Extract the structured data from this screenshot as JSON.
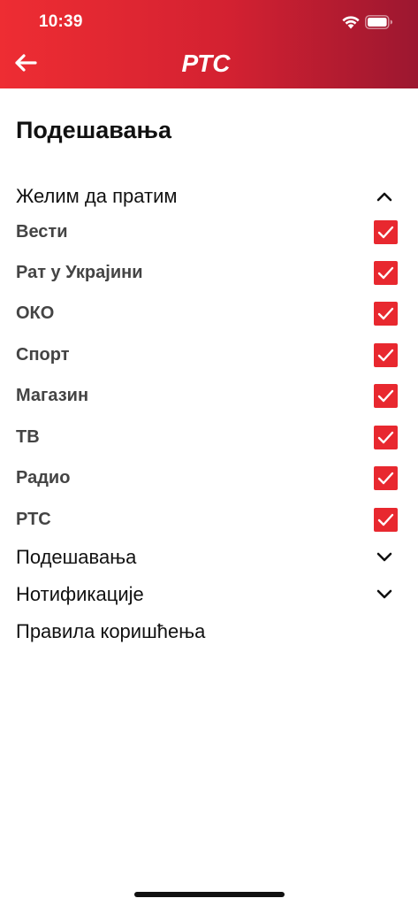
{
  "status_bar": {
    "time": "10:39"
  },
  "header": {
    "logo_text": "РТС",
    "back_icon": "arrow-left-icon",
    "colors": {
      "start": "#ee2d33",
      "end": "#9c1730"
    }
  },
  "page": {
    "title": "Подешавања"
  },
  "sections": {
    "follow": {
      "label": "Желим да пратим",
      "expanded": true
    },
    "settings": {
      "label": "Подешавања",
      "expanded": false
    },
    "notifications": {
      "label": "Нотификације",
      "expanded": false
    },
    "terms": {
      "label": "Правила коришћења"
    }
  },
  "topics": [
    {
      "label": "Вести",
      "checked": true
    },
    {
      "label": "Рат у Украјини",
      "checked": true
    },
    {
      "label": "ОКО",
      "checked": true
    },
    {
      "label": "Спорт",
      "checked": true
    },
    {
      "label": "Магазин",
      "checked": true
    },
    {
      "label": "ТВ",
      "checked": true
    },
    {
      "label": "Радио",
      "checked": true
    },
    {
      "label": "РТС",
      "checked": true
    }
  ],
  "accent_color": "#e8282f"
}
